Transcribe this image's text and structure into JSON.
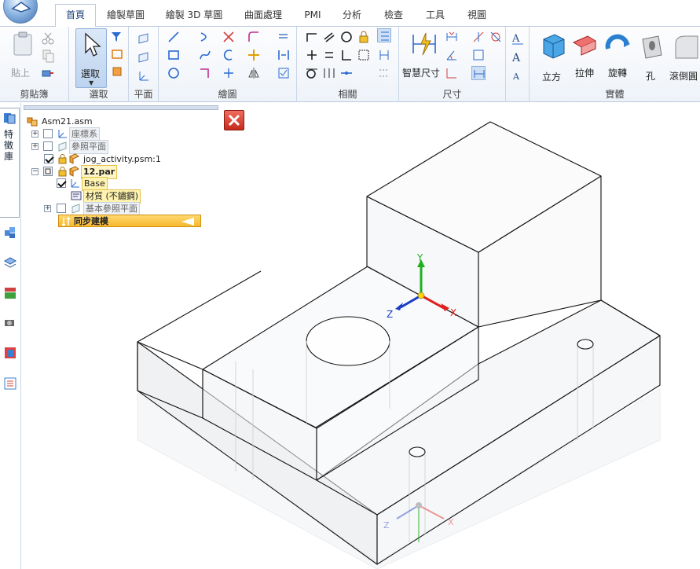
{
  "tabs": [
    "首頁",
    "繪製草圖",
    "繪製 3D 草圖",
    "曲面處理",
    "PMI",
    "分析",
    "檢查",
    "工具",
    "視圖"
  ],
  "active_tab": "首頁",
  "ribbon": {
    "groups": {
      "clipboard": "剪貼簿",
      "select": "選取",
      "plane": "平面",
      "draw": "繪圖",
      "relate": "相關",
      "dimension": "尺寸",
      "solids": "實體"
    },
    "paste_label": "貼上",
    "select_label": "選取",
    "smart_dimension_label": "智慧尺寸",
    "cube_label": "立方",
    "extrude_label": "拉伸",
    "revolve_label": "旋轉",
    "hole_label": "孔",
    "round_label": "滾倒圓"
  },
  "sidebar": {
    "vertical_tab_label": "特徵庫"
  },
  "tree": {
    "root": "Asm21.asm",
    "coordinate_systems": "座標系",
    "reference_planes": "參照平面",
    "part_psm": "jog_activity.psm:1",
    "part_par": "12.par",
    "base": "Base",
    "material": "材質 (不鏽鋼)",
    "base_reference_planes": "基本參照平面",
    "synchronous": "同步建模"
  },
  "triad": {
    "x": "X",
    "y": "Y",
    "z": "Z"
  },
  "colors": {
    "accent": "#1a3f7a",
    "highlight": "#ffd45a",
    "axis_x": "#e02020",
    "axis_y": "#20b020",
    "axis_z": "#1a3cc8"
  }
}
